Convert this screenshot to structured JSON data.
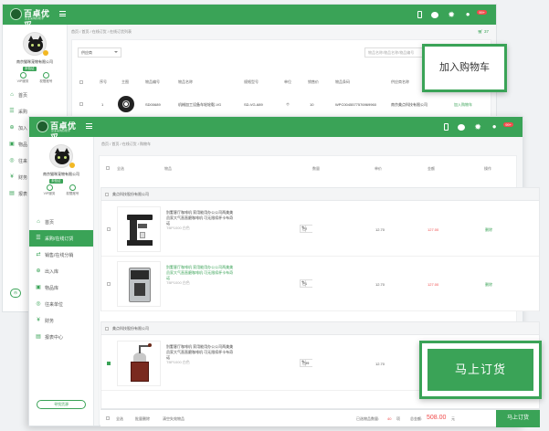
{
  "window_a": {
    "logo": {
      "brand": "百卓优采",
      "slogan": "企业采购好帮手"
    },
    "topbar_badge": "99+",
    "profile": {
      "company": "南京猫咪宠物有限公司",
      "tag": "未验证",
      "vip_label": "VIP服务",
      "perm_label": "权限账号"
    },
    "nav": [
      "首页",
      "采购",
      "加入",
      "物品",
      "往来",
      "财务",
      "报表"
    ],
    "side_button": "市",
    "breadcrumb": "首页 / 首页 / 在线订货 / 在线订货列表",
    "cart_count": "37",
    "supplier_select": "供应商",
    "search_placeholder": "物品名称/物品名称/物品编号",
    "table_headers": [
      "序号",
      "主图",
      "物品编号",
      "物品名称",
      "规格型号",
      "单位",
      "销售价",
      "物品条码",
      "供应商名称",
      "操作"
    ],
    "row": {
      "index": "1",
      "code": "SD00689",
      "name": "机械加工设备车轮轮毂-VG",
      "spec": "SD-VG-689",
      "unit": "个",
      "price": "10",
      "barcode": "WPC0045577576969960",
      "supplier": "南京美点科技有限公司",
      "action": "加入购物车"
    }
  },
  "window_b": {
    "logo": {
      "brand": "百卓优采",
      "slogan": "企业采购好帮手"
    },
    "topbar_badge": "99+",
    "profile": {
      "company": "南京猫咪宠物有限公司",
      "tag": "未验证",
      "vip_label": "VIP服务",
      "perm_label": "权限账号"
    },
    "nav": [
      "首页",
      "采购/在线订货",
      "销售/在线分销",
      "出入库",
      "物品库",
      "往来单位",
      "财务",
      "报表中心"
    ],
    "side_button": "寻找货源",
    "breadcrumb": "首页 / 首页 / 在线订货 / 购物车",
    "headers": {
      "select_all": "全选",
      "product": "物品",
      "qty": "数量",
      "unit_price": "单价",
      "amount": "金额",
      "action": "操作"
    },
    "groups": [
      {
        "supplier": "美点科技股份有限公司",
        "items": [
          {
            "desc": "别墅客厅咖啡机 家用能用办公公司两美美员家大气直直磨咖啡机 可无限续杯卡布奇诺",
            "spec": "TBP1000 白色",
            "qty": "2",
            "unit": "台",
            "price": "12.70",
            "amount": "127.00",
            "action": "删除"
          },
          {
            "desc": "别墅客厅咖啡机 家用能用办公公司两美美员家大气直直磨咖啡机 可无限续杯卡布奇诺",
            "spec": "TBP1000 白色",
            "qty": "1",
            "unit": "台",
            "price": "12.70",
            "amount": "127.00",
            "action": "删除"
          }
        ]
      },
      {
        "supplier": "美点科技股份有限公司",
        "items": [
          {
            "desc": "别墅客厅咖啡机 家用能用办公公司两美美员家大气直直磨咖啡机 可无限续杯卡布奇诺",
            "spec": "TBP1000 白色",
            "qty": "999",
            "unit": "台",
            "price": "12.70",
            "amount": "127.00",
            "action": "删除"
          }
        ]
      }
    ],
    "bottom": {
      "select_all": "全选",
      "batch_delete": "批量删除",
      "clear_invalid": "清空失效物品",
      "selected_label": "已选物品数量:",
      "selected_count": "40",
      "unit": "项",
      "total_label": "总金额:",
      "total": "508.00",
      "currency": "元",
      "checkout": "马上订货"
    }
  },
  "callouts": {
    "add_to_cart": "加入购物车",
    "order_now": "马上订货"
  },
  "colors": {
    "brand_green": "#3aa357",
    "price_red": "#f04b4b"
  }
}
